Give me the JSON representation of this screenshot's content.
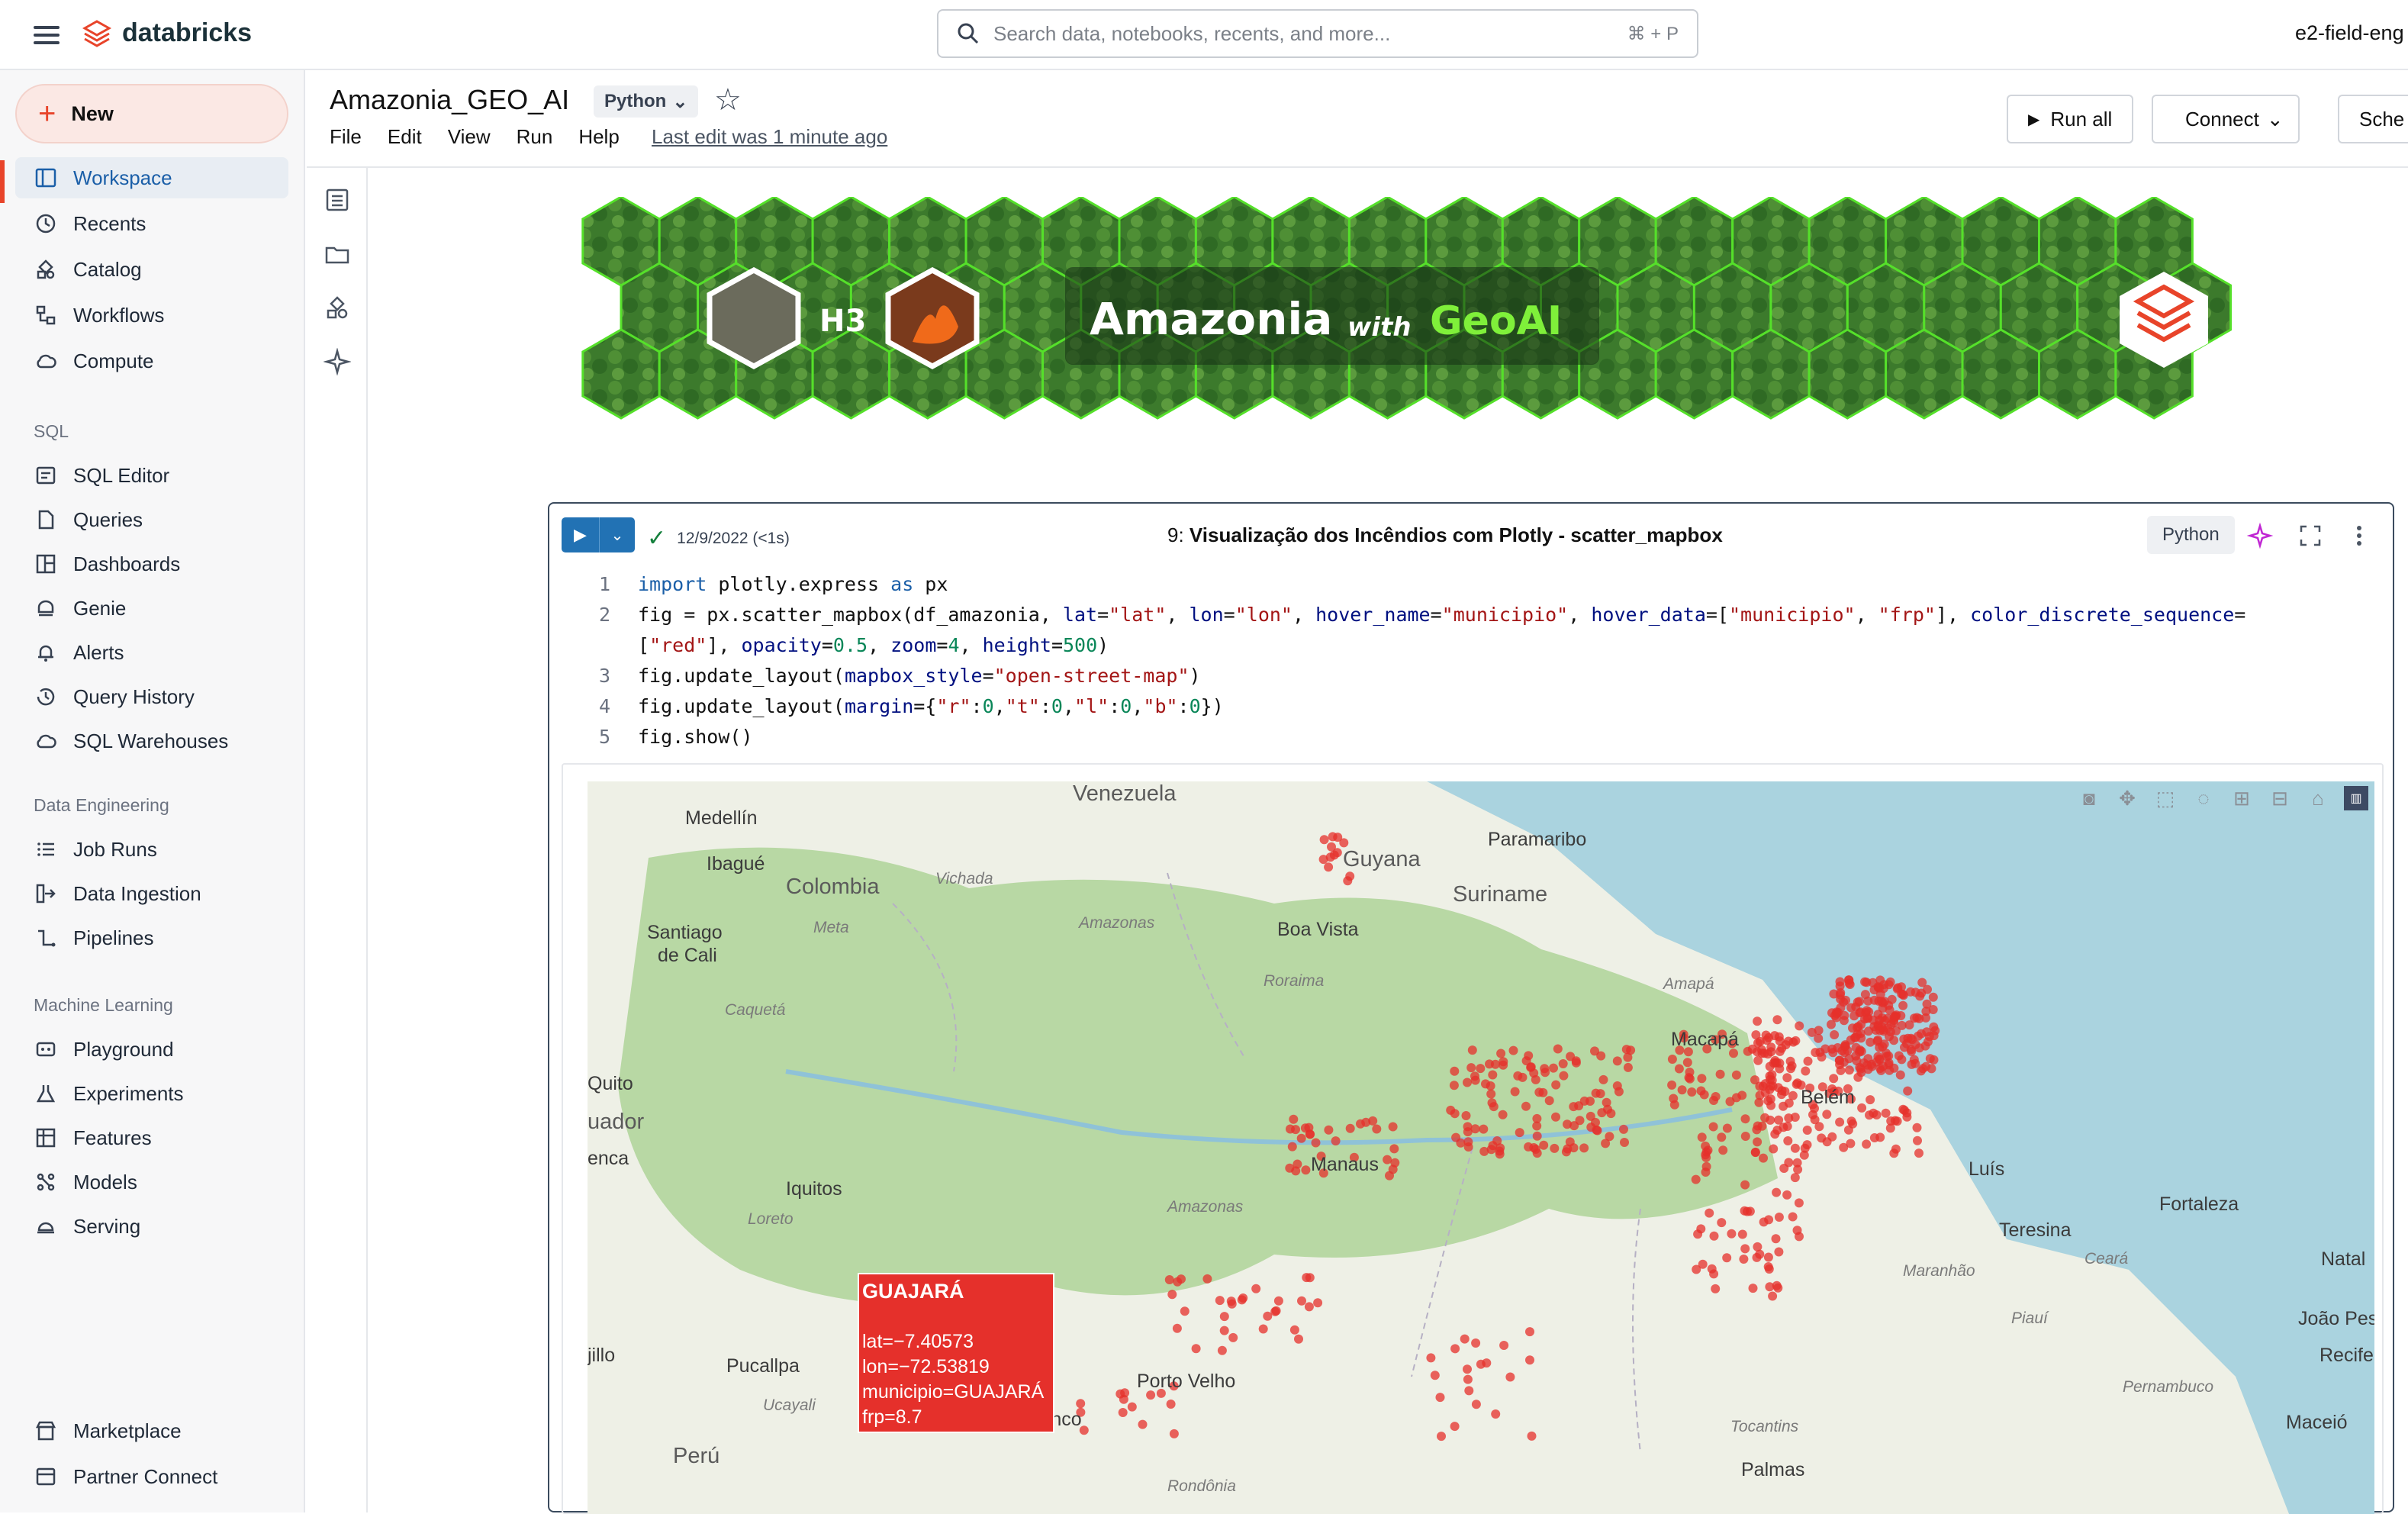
{
  "topbar": {
    "brand": "databricks",
    "search_placeholder": "Search data, notebooks, recents, and more...",
    "search_shortcut": "⌘ + P",
    "workspace": "e2-field-eng"
  },
  "sidebar": {
    "new_label": "New",
    "main": [
      {
        "label": "Workspace",
        "icon": "workspace-icon"
      },
      {
        "label": "Recents",
        "icon": "clock-icon"
      },
      {
        "label": "Catalog",
        "icon": "catalog-icon"
      },
      {
        "label": "Workflows",
        "icon": "workflows-icon"
      },
      {
        "label": "Compute",
        "icon": "cloud-icon"
      }
    ],
    "sql_title": "SQL",
    "sql": [
      {
        "label": "SQL Editor"
      },
      {
        "label": "Queries"
      },
      {
        "label": "Dashboards"
      },
      {
        "label": "Genie"
      },
      {
        "label": "Alerts"
      },
      {
        "label": "Query History"
      },
      {
        "label": "SQL Warehouses"
      }
    ],
    "de_title": "Data Engineering",
    "de": [
      {
        "label": "Job Runs"
      },
      {
        "label": "Data Ingestion"
      },
      {
        "label": "Pipelines"
      }
    ],
    "ml_title": "Machine Learning",
    "ml": [
      {
        "label": "Playground"
      },
      {
        "label": "Experiments"
      },
      {
        "label": "Features"
      },
      {
        "label": "Models"
      },
      {
        "label": "Serving"
      }
    ],
    "bottom": [
      {
        "label": "Marketplace"
      },
      {
        "label": "Partner Connect"
      }
    ]
  },
  "notebook": {
    "title": "Amazonia_GEO_AI",
    "language": "Python",
    "menu": [
      "File",
      "Edit",
      "View",
      "Run",
      "Help"
    ],
    "last_edit": "Last edit was 1 minute ago",
    "run_all": "Run all",
    "connect": "Connect",
    "schedule": "Sche"
  },
  "banner": {
    "h3": "H3",
    "title": "Amazonia",
    "with": "with",
    "geoai": "GeoAI"
  },
  "cell": {
    "status": "12/9/2022 (<1s)",
    "number": "9:",
    "title": "Visualização dos Incêndios com Plotly - scatter_mapbox",
    "language": "Python",
    "line_numbers": [
      "1",
      "2",
      "",
      "3",
      "4",
      "5"
    ]
  },
  "map": {
    "labels": {
      "venezuela": "Venezuela",
      "medellin": "Medellín",
      "ibague": "Ibagué",
      "colombia": "Colombia",
      "vichada": "Vichada",
      "guyana": "Guyana",
      "paramaribo": "Paramaribo",
      "suriname": "Suriname",
      "meta": "Meta",
      "amazonas1": "Amazonas",
      "boavista": "Boa Vista",
      "santiago": "Santiago",
      "decali": "de Cali",
      "caqueta": "Caquetá",
      "roraima": "Roraima",
      "amapa": "Amapá",
      "macapa": "Macapá",
      "quito": "Quito",
      "uador": "uador",
      "enca": "enca",
      "belem": "Belém",
      "manaus": "Manaus",
      "iquitos": "Iquitos",
      "amazonas2": "Amazonas",
      "luis": "Luís",
      "loreto": "Loreto",
      "fortaleza": "Fortaleza",
      "teresina": "Teresina",
      "ceara": "Ceará",
      "maranhao": "Maranhão",
      "natal": "Natal",
      "piaui": "Piauí",
      "joaopes": "João Pes",
      "recife": "Recife",
      "jillo": "jillo",
      "pucallpa": "Pucallpa",
      "portovelho": "Porto Velho",
      "pernambuco": "Pernambuco",
      "ucayali": "Ucayali",
      "riobranco": "Rio Branco",
      "tocantins": "Tocantins",
      "maceio": "Maceió",
      "peru": "Perú",
      "rondonia": "Rondônia",
      "palmas": "Palmas"
    },
    "tooltip": {
      "name": "GUAJARÁ",
      "lat": "lat=−7.40573",
      "lon": "lon=−72.53819",
      "municipio": "municipio=GUAJARÁ",
      "frp": "frp=8.7"
    },
    "colors": {
      "points": "#e5302b",
      "land": "#d8e6c9",
      "ocean": "#aad3df",
      "forest": "#add19e"
    }
  }
}
